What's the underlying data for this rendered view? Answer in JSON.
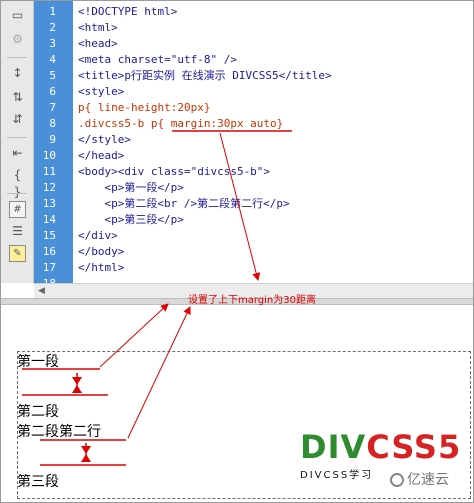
{
  "editor": {
    "line_numbers": [
      "1",
      "2",
      "3",
      "4",
      "5",
      "6",
      "7",
      "8",
      "9",
      "10",
      "11",
      "12",
      "13",
      "14",
      "15",
      "16",
      "17",
      "18"
    ],
    "lines": [
      "<!DOCTYPE html>",
      "<html>",
      "<head>",
      "<meta charset=\"utf-8\" />",
      "<title>p行距实例 在线演示 DIVCSS5</title>",
      "<style>",
      "p{ line-height:20px}",
      ".divcss5-b p{ margin:30px auto}",
      "</style>",
      "</head>",
      "<body><div class=\"divcss5-b\">",
      "    <p>第一段</p>",
      "    <p>第二段<br />第二段第二行</p>",
      "    <p>第三段</p>",
      "</div>",
      "</body>",
      "</html>",
      ""
    ]
  },
  "toolbar": {
    "icons": [
      "document-icon",
      "gear-icon",
      "expand-tag-icon",
      "select-parent-icon",
      "collapse-icon",
      "indent-icon",
      "braces-icon",
      "format-icon",
      "hash-icon",
      "highlight-icon"
    ]
  },
  "design": {
    "paragraphs": [
      "第一段",
      "第二段",
      "第二段第二行",
      "第三段"
    ]
  },
  "annotation": "设置了上下margin为30距离",
  "logo": {
    "main_green": "DIV",
    "main_red": "CSS5",
    "sub": "DIVCSS学习"
  },
  "watermark": "亿速云",
  "colors": {
    "gutter": "#4a90d9",
    "annotation_red": "#e00000",
    "logo_green": "#2e8b2e",
    "logo_red": "#d62222"
  }
}
